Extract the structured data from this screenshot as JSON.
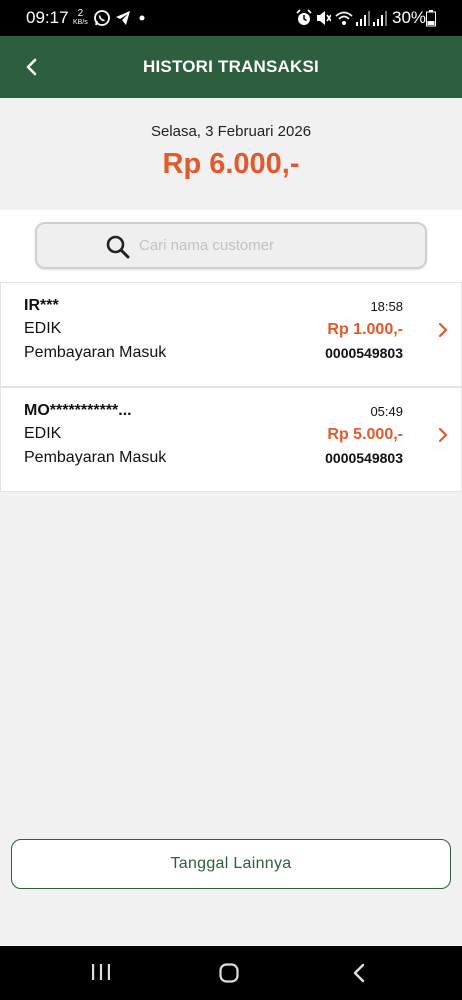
{
  "status_bar": {
    "time": "09:17",
    "net_speed_value": "2",
    "net_speed_unit": "KB/s",
    "battery": "30%",
    "icons": [
      "whatsapp-icon",
      "telegram-icon",
      "dot-icon",
      "alarm-icon",
      "mute-icon",
      "wifi-icon",
      "signal-icon",
      "signal-icon",
      "battery-icon"
    ]
  },
  "header": {
    "title": "HISTORI TRANSAKSI",
    "back_icon": "chevron-left-icon"
  },
  "summary": {
    "date": "Selasa, 3 Februari 2026",
    "total": "Rp 6.000,-"
  },
  "search": {
    "placeholder": "Cari nama customer",
    "icon": "search-icon"
  },
  "transactions": [
    {
      "name": "IR***",
      "time": "18:58",
      "bank": "EDIK",
      "amount": "Rp 1.000,-",
      "type": "Pembayaran Masuk",
      "ref": "0000549803"
    },
    {
      "name": "MO***********...",
      "time": "05:49",
      "bank": "EDIK",
      "amount": "Rp 5.000,-",
      "type": "Pembayaran Masuk",
      "ref": "0000549803"
    }
  ],
  "footer": {
    "more_label": "Tanggal Lainnya"
  },
  "colors": {
    "primary": "#2d5f3e",
    "accent": "#e05a2b",
    "background": "#f1f1f1"
  },
  "nav_bar": {
    "icons": [
      "recent-apps-icon",
      "home-icon",
      "back-icon"
    ]
  }
}
